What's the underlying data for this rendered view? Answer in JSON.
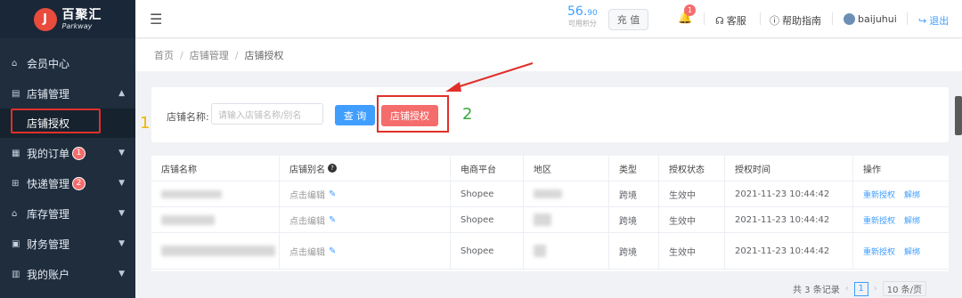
{
  "logo": {
    "cn": "百聚汇",
    "en": "Parkway"
  },
  "sidebar": {
    "items": [
      {
        "label": "会员中心",
        "icon": "home-icon",
        "chev": ""
      },
      {
        "label": "店铺管理",
        "icon": "shop-icon",
        "chev": "▲"
      },
      {
        "label": "我的订单",
        "icon": "order-icon",
        "chev": "▼",
        "badge": "1"
      },
      {
        "label": "快递管理",
        "icon": "express-icon",
        "chev": "▼",
        "badge": "2"
      },
      {
        "label": "库存管理",
        "icon": "warehouse-icon",
        "chev": "▼"
      },
      {
        "label": "财务管理",
        "icon": "finance-icon",
        "chev": "▼"
      },
      {
        "label": "我的账户",
        "icon": "account-icon",
        "chev": "▼"
      }
    ],
    "sub_item": "店铺授权"
  },
  "header": {
    "credits_int": "56.",
    "credits_dec": "90",
    "credits_label": "可用积分",
    "recharge": "充 值",
    "bell_badge": "1",
    "service": "客服",
    "help": "帮助指南",
    "user": "baijuhui",
    "logout": "退出"
  },
  "breadcrumb": [
    "首页",
    "店铺管理",
    "店铺授权"
  ],
  "search": {
    "label": "店铺名称:",
    "placeholder": "请输入店铺名称/别名",
    "query": "查 询",
    "authorize": "店铺授权"
  },
  "steps": {
    "one": "1",
    "two": "2"
  },
  "table": {
    "headers": [
      "店铺名称",
      "店铺别名",
      "电商平台",
      "地区",
      "类型",
      "授权状态",
      "授权时间",
      "操作"
    ],
    "rows": [
      {
        "alias": "点击编辑",
        "platform": "Shopee",
        "type": "跨境",
        "status": "生效中",
        "time": "2021-11-23 10:44:42",
        "op1": "重新授权",
        "op2": "解绑"
      },
      {
        "alias": "点击编辑",
        "platform": "Shopee",
        "type": "跨境",
        "status": "生效中",
        "time": "2021-11-23 10:44:42",
        "op1": "重新授权",
        "op2": "解绑"
      },
      {
        "alias": "点击编辑",
        "platform": "Shopee",
        "type": "跨境",
        "status": "生效中",
        "time": "2021-11-23 10:44:42",
        "op1": "重新授权",
        "op2": "解绑"
      }
    ]
  },
  "pager": {
    "total": "共 3 条记录",
    "page": "1",
    "size": "10 条/页"
  },
  "colors": {
    "accent": "#409eff",
    "danger": "#f56c6c",
    "sidebar": "#1f2d3d",
    "highlight": "#e0302a"
  }
}
